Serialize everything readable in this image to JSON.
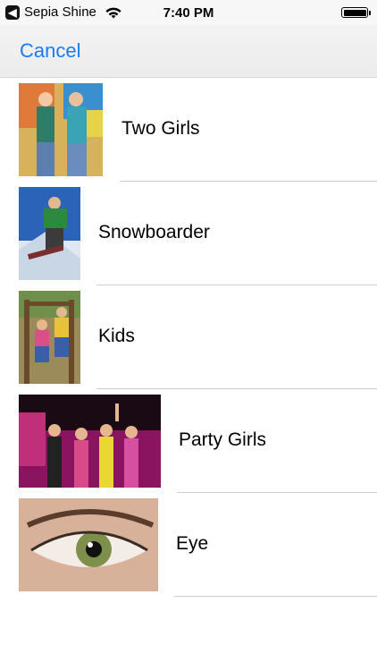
{
  "status_bar": {
    "back_app": "Sepia Shine",
    "time": "7:40 PM",
    "battery_level": 1.0
  },
  "nav": {
    "cancel_label": "Cancel"
  },
  "items": [
    {
      "label": "Two Girls",
      "thumbnail": "two-girls-photo"
    },
    {
      "label": "Snowboarder",
      "thumbnail": "snowboarder-photo"
    },
    {
      "label": "Kids",
      "thumbnail": "kids-photo"
    },
    {
      "label": "Party Girls",
      "thumbnail": "party-girls-photo"
    },
    {
      "label": "Eye",
      "thumbnail": "eye-photo"
    }
  ]
}
